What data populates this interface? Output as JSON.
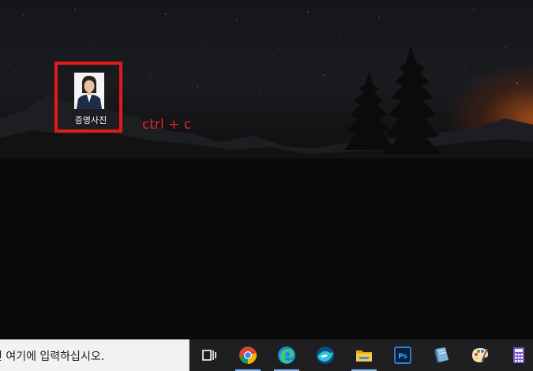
{
  "desktop": {
    "icons": [
      {
        "label": "증명사진",
        "icon": "id-photo-icon"
      }
    ],
    "annotation": "ctrl + c",
    "highlight_color": "#e01b1b"
  },
  "taskbar": {
    "search_text": "면 여기에 입력하십시오.",
    "apps": [
      {
        "name": "task-view",
        "icon": "task-view-icon"
      },
      {
        "name": "chrome",
        "icon": "chrome-icon"
      },
      {
        "name": "edge",
        "icon": "edge-icon"
      },
      {
        "name": "app-blue-wave",
        "icon": "wave-app-icon"
      },
      {
        "name": "file-explorer",
        "icon": "folder-icon"
      },
      {
        "name": "photoshop",
        "icon": "photoshop-icon",
        "text": "Ps"
      },
      {
        "name": "book-app",
        "icon": "book-icon"
      },
      {
        "name": "paint",
        "icon": "paint-palette-icon"
      },
      {
        "name": "calculator",
        "icon": "calculator-icon"
      }
    ],
    "colors": {
      "background": "#1f1f22",
      "search_bg": "#f2f2f2",
      "active_underline": "#8fb8e8"
    }
  }
}
